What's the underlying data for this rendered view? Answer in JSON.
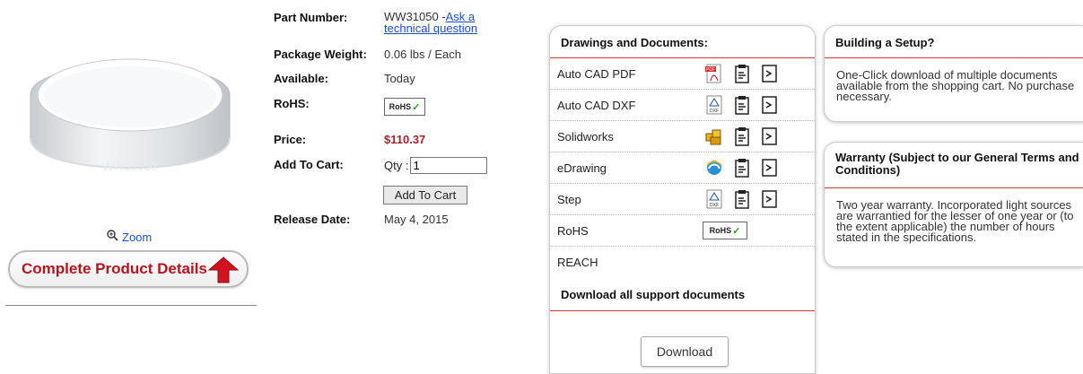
{
  "product": {
    "image_alt": "Window product image",
    "engraving": "WW31050",
    "zoom_label": "Zoom",
    "details_button": "Complete Product Details"
  },
  "specs": {
    "part_number_label": "Part Number:",
    "part_number_value": "WW31050 -",
    "ask_question_line1": "Ask a",
    "ask_question_line2": "technical question",
    "weight_label": "Package Weight:",
    "weight_value": "0.06 lbs / Each",
    "available_label": "Available:",
    "available_value": "Today",
    "rohs_label": "RoHS:",
    "rohs_badge": "RoHS",
    "price_label": "Price:",
    "price_value": "$110.37",
    "cart_label": "Add To Cart:",
    "qty_label": "Qty :",
    "qty_value": "1",
    "add_to_cart": "Add To Cart",
    "release_label": "Release Date:",
    "release_value": "May 4, 2015"
  },
  "documents": {
    "heading": "Drawings and Documents:",
    "rows": [
      {
        "label": "Auto CAD PDF",
        "icon": "pdf-icon"
      },
      {
        "label": "Auto CAD DXF",
        "icon": "dxf-icon"
      },
      {
        "label": "Solidworks",
        "icon": "solidworks-icon"
      },
      {
        "label": "eDrawing",
        "icon": "edrawing-icon"
      },
      {
        "label": "Step",
        "icon": "dxf-icon"
      },
      {
        "label": "RoHS",
        "icon": "rohs-badge"
      },
      {
        "label": "REACH",
        "icon": ""
      }
    ],
    "rohs_badge": "RoHS",
    "download_all_heading": "Download all support documents",
    "download_button": "Download"
  },
  "setup": {
    "heading": "Building a Setup?",
    "body": "One-Click download of multiple documents available from the shopping cart. No purchase necessary."
  },
  "warranty": {
    "heading": "Warranty (Subject to our General Terms and Conditions)",
    "body": "Two year warranty. Incorporated light sources are warrantied for the lesser of one year or (to the extent applicable) the number of hours stated in the specifications."
  },
  "colors": {
    "accent_red": "#d23a3a",
    "price_red": "#a0262b",
    "link_blue": "#1a4fd6"
  }
}
